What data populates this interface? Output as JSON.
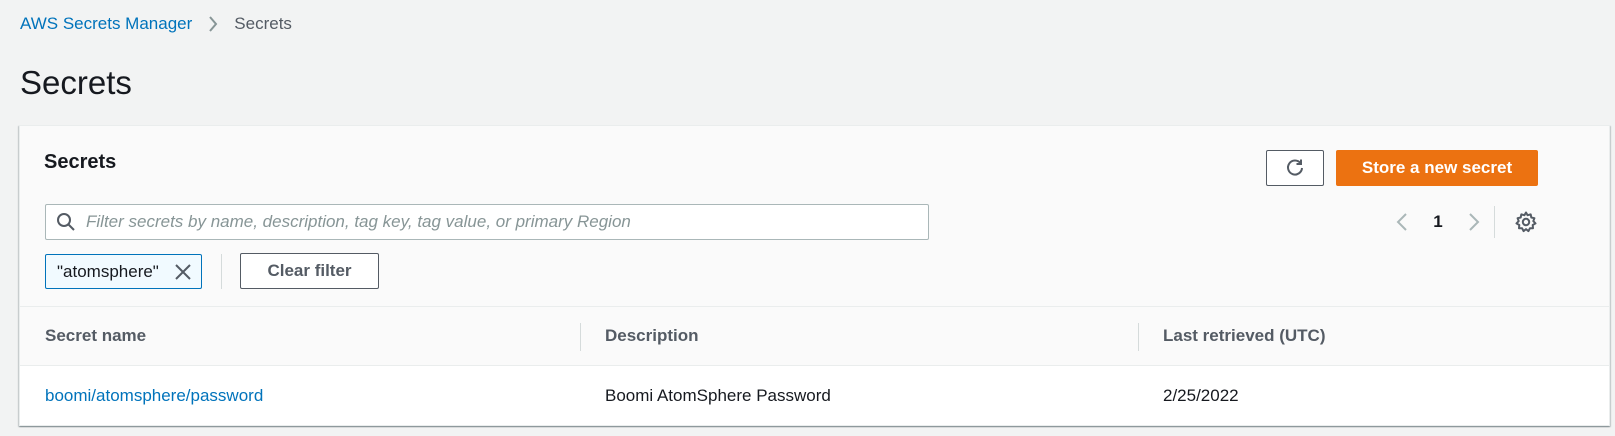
{
  "breadcrumb": {
    "service": "AWS Secrets Manager",
    "current": "Secrets"
  },
  "page_title": "Secrets",
  "panel": {
    "title": "Secrets",
    "store_button": "Store a new secret",
    "search_placeholder": "Filter secrets by name, description, tag key, tag value, or primary Region",
    "search_value": "",
    "filter_token": "\"atomsphere\"",
    "clear_filter": "Clear filter",
    "page_number": "1"
  },
  "table": {
    "columns": [
      "Secret name",
      "Description",
      "Last retrieved (UTC)"
    ],
    "rows": [
      {
        "name": "boomi/atomsphere/password",
        "description": "Boomi AtomSphere Password",
        "last_retrieved": "2/25/2022"
      }
    ]
  },
  "icons": {
    "breadcrumb_separator": "chevron-right-icon",
    "refresh": "refresh-icon",
    "search": "search-icon",
    "previous": "chevron-left-icon",
    "next": "chevron-right-icon",
    "settings": "gear-icon",
    "remove_token": "close-icon"
  },
  "colors": {
    "link": "#0073bb",
    "primary_button": "#ec7211",
    "background": "#f2f3f3"
  }
}
